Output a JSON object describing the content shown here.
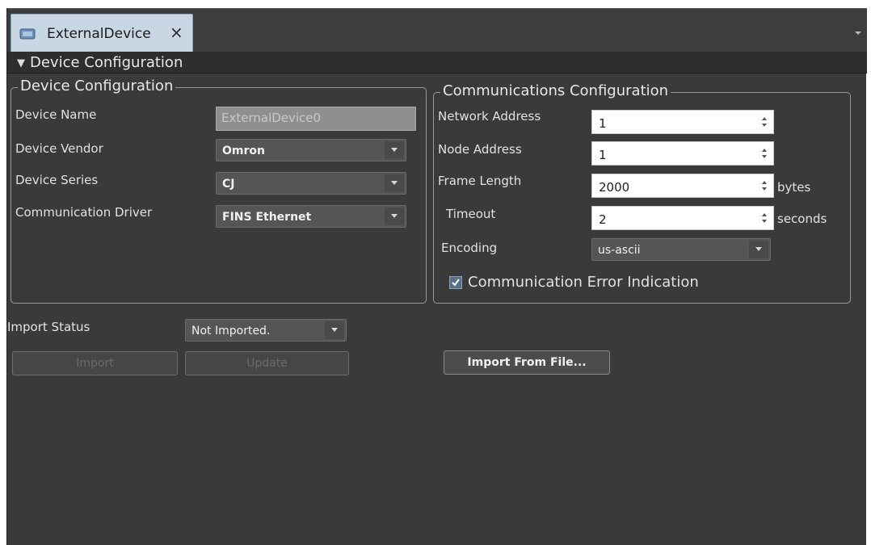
{
  "tab": {
    "label": "ExternalDevice",
    "close_glyph": "×",
    "icon": "device-icon"
  },
  "section": {
    "toggle_glyph": "▼",
    "title": "Device Configuration"
  },
  "device_config": {
    "legend": "Device Configuration",
    "device_name_label": "Device Name",
    "device_name_value": "ExternalDevice0",
    "device_vendor_label": "Device Vendor",
    "device_vendor_value": "Omron",
    "device_series_label": "Device Series",
    "device_series_value": "CJ",
    "comm_driver_label": "Communication Driver",
    "comm_driver_value": "FINS Ethernet"
  },
  "comm_config": {
    "legend": "Communications Configuration",
    "network_address_label": "Network Address",
    "network_address_value": "1",
    "node_address_label": "Node Address",
    "node_address_value": "1",
    "frame_length_label": "Frame Length",
    "frame_length_value": "2000",
    "frame_length_unit": "bytes",
    "timeout_label": "Timeout",
    "timeout_value": "2",
    "timeout_unit": "seconds",
    "encoding_label": "Encoding",
    "encoding_value": "us-ascii",
    "error_indication_label": "Communication Error Indication",
    "error_indication_checked": true
  },
  "import": {
    "status_label": "Import Status",
    "status_value": "Not Imported.",
    "import_button": "Import",
    "update_button": "Update",
    "import_from_file_button": "Import From File..."
  },
  "colors": {
    "panel": "#3a3a3a",
    "tab_active": "#c9d6e3",
    "combo": "#555555",
    "checkbox": "#5a6e86"
  }
}
